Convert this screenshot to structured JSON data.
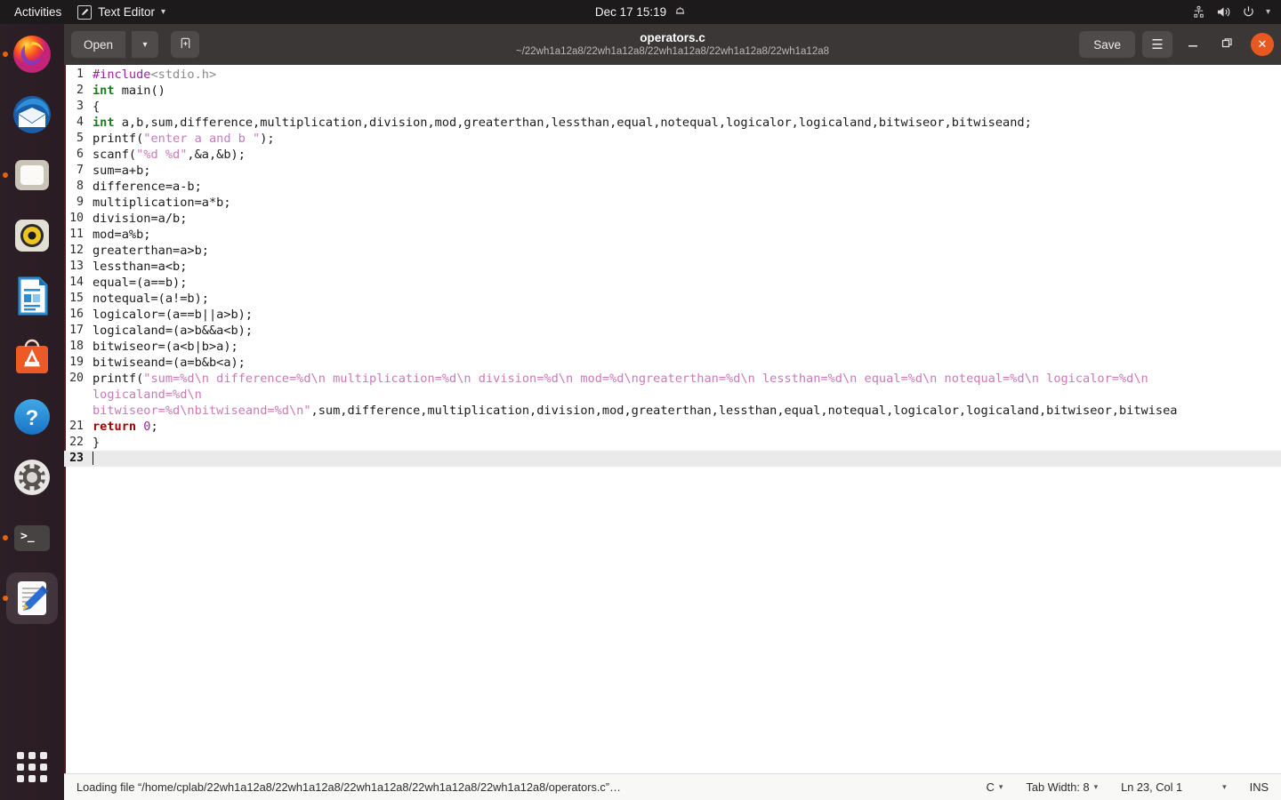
{
  "topbar": {
    "activities": "Activities",
    "app_name": "Text Editor",
    "app_icon": "pencil-document-icon",
    "clock": "Dec 17  15:19",
    "bell_icon": "notification-bell-icon",
    "tray_icons": [
      "accessibility-icon",
      "volume-icon",
      "power-icon",
      "chevron-down-icon"
    ]
  },
  "dock": {
    "items": [
      {
        "name": "firefox",
        "icon": "firefox-icon",
        "running": true,
        "active": false
      },
      {
        "name": "thunderbird",
        "icon": "thunderbird-mail-icon",
        "running": false,
        "active": false
      },
      {
        "name": "files",
        "icon": "files-folder-icon",
        "running": true,
        "active": false
      },
      {
        "name": "rhythmbox",
        "icon": "rhythmbox-speaker-icon",
        "running": false,
        "active": false
      },
      {
        "name": "libreoffice-writer",
        "icon": "libreoffice-writer-icon",
        "running": false,
        "active": false
      },
      {
        "name": "ubuntu-software",
        "icon": "ubuntu-software-bag-icon",
        "running": false,
        "active": false
      },
      {
        "name": "help",
        "icon": "help-question-icon",
        "running": false,
        "active": false
      },
      {
        "name": "settings",
        "icon": "settings-gear-icon",
        "running": false,
        "active": false
      },
      {
        "name": "terminal",
        "icon": "terminal-prompt-icon",
        "running": true,
        "active": false
      },
      {
        "name": "text-editor",
        "icon": "text-editor-pencil-icon",
        "running": true,
        "active": true
      }
    ],
    "show_apps_label": "Show Applications"
  },
  "window": {
    "title": "operators.c",
    "subtitle": "~/22wh1a12a8/22wh1a12a8/22wh1a12a8/22wh1a12a8/22wh1a12a8",
    "open_label": "Open",
    "open_arrow_icon": "chevron-down-icon",
    "new_tab_icon": "new-document-icon",
    "save_label": "Save",
    "menu_icon": "hamburger-menu-icon",
    "minimize_icon": "minimize-icon",
    "maximize_icon": "maximize-restore-icon",
    "close_icon": "close-x-icon"
  },
  "editor": {
    "current_line": 23,
    "lines": [
      {
        "n": "1",
        "segs": [
          {
            "t": "#include",
            "c": "pre"
          },
          {
            "t": "<stdio.h>",
            "c": "inc"
          }
        ]
      },
      {
        "n": "2",
        "segs": [
          {
            "t": "int",
            "c": "kw"
          },
          {
            "t": " main()",
            "c": ""
          }
        ]
      },
      {
        "n": "3",
        "segs": [
          {
            "t": "{",
            "c": ""
          }
        ]
      },
      {
        "n": "4",
        "segs": [
          {
            "t": "int",
            "c": "kw"
          },
          {
            "t": " a,b,sum,difference,multiplication,division,mod,greaterthan,lessthan,equal,notequal,logicalor,logicaland,bitwiseor,bitwiseand;",
            "c": ""
          }
        ]
      },
      {
        "n": "5",
        "segs": [
          {
            "t": "printf(",
            "c": ""
          },
          {
            "t": "\"enter a and b \"",
            "c": "str"
          },
          {
            "t": ");",
            "c": ""
          }
        ]
      },
      {
        "n": "6",
        "segs": [
          {
            "t": "scanf(",
            "c": ""
          },
          {
            "t": "\"%d %d\"",
            "c": "str"
          },
          {
            "t": ",&a,&b);",
            "c": ""
          }
        ]
      },
      {
        "n": "7",
        "segs": [
          {
            "t": "sum=a+b;",
            "c": ""
          }
        ]
      },
      {
        "n": "8",
        "segs": [
          {
            "t": "difference=a-b;",
            "c": ""
          }
        ]
      },
      {
        "n": "9",
        "segs": [
          {
            "t": "multiplication=a*b;",
            "c": ""
          }
        ]
      },
      {
        "n": "10",
        "segs": [
          {
            "t": "division=a/b;",
            "c": ""
          }
        ]
      },
      {
        "n": "11",
        "segs": [
          {
            "t": "mod=a%b;",
            "c": ""
          }
        ]
      },
      {
        "n": "12",
        "segs": [
          {
            "t": "greaterthan=a>b;",
            "c": ""
          }
        ]
      },
      {
        "n": "13",
        "segs": [
          {
            "t": "lessthan=a<b;",
            "c": ""
          }
        ]
      },
      {
        "n": "14",
        "segs": [
          {
            "t": "equal=(a==b);",
            "c": ""
          }
        ]
      },
      {
        "n": "15",
        "segs": [
          {
            "t": "notequal=(a!=b);",
            "c": ""
          }
        ]
      },
      {
        "n": "16",
        "segs": [
          {
            "t": "logicalor=(a==b||a>b);",
            "c": ""
          }
        ]
      },
      {
        "n": "17",
        "segs": [
          {
            "t": "logicaland=(a>b&&a<b);",
            "c": ""
          }
        ]
      },
      {
        "n": "18",
        "segs": [
          {
            "t": "bitwiseor=(a<b|b>a);",
            "c": ""
          }
        ]
      },
      {
        "n": "19",
        "segs": [
          {
            "t": "bitwiseand=(a=b&b<a);",
            "c": ""
          }
        ]
      },
      {
        "n": "20",
        "segs": [
          {
            "t": "printf(",
            "c": ""
          },
          {
            "t": "\"sum=%d\\n difference=%d\\n multiplication=%d\\n division=%d\\n mod=%d\\ngreaterthan=%d\\n lessthan=%d\\n equal=%d\\n notequal=%d\\n logicalor=%d\\n",
            "c": "str"
          }
        ]
      },
      {
        "n": "",
        "segs": [
          {
            "t": "logicaland=%d\\n",
            "c": "str"
          }
        ]
      },
      {
        "n": "",
        "segs": [
          {
            "t": "bitwiseor=%d\\nbitwiseand=%d\\n\"",
            "c": "str"
          },
          {
            "t": ",sum,difference,multiplication,division,mod,greaterthan,lessthan,equal,notequal,logicalor,logicaland,bitwiseor,bitwisea",
            "c": ""
          }
        ]
      },
      {
        "n": "21",
        "segs": [
          {
            "t": "return",
            "c": "kw-red"
          },
          {
            "t": " ",
            "c": ""
          },
          {
            "t": "0",
            "c": "num"
          },
          {
            "t": ";",
            "c": ""
          }
        ]
      },
      {
        "n": "22",
        "segs": [
          {
            "t": "}",
            "c": ""
          }
        ]
      },
      {
        "n": "23",
        "segs": [],
        "current": true
      }
    ]
  },
  "statusbar": {
    "message": "Loading file “/home/cplab/22wh1a12a8/22wh1a12a8/22wh1a12a8/22wh1a12a8/22wh1a12a8/operators.c”…",
    "language": "C",
    "tab_width": "Tab Width: 8",
    "position": "Ln 23, Col 1",
    "insert_mode": "INS",
    "chevron_icon": "chevron-down-icon"
  },
  "colors": {
    "accent": "#e8591f",
    "dock_bg": "#2b1d25",
    "topbar_bg": "#1d1a1b",
    "headerbar_bg": "#3b3737",
    "keyword_green": "#1a7c1a",
    "keyword_red": "#a40000",
    "string_pink": "#c979b8",
    "preproc_purple": "#a020a0"
  }
}
